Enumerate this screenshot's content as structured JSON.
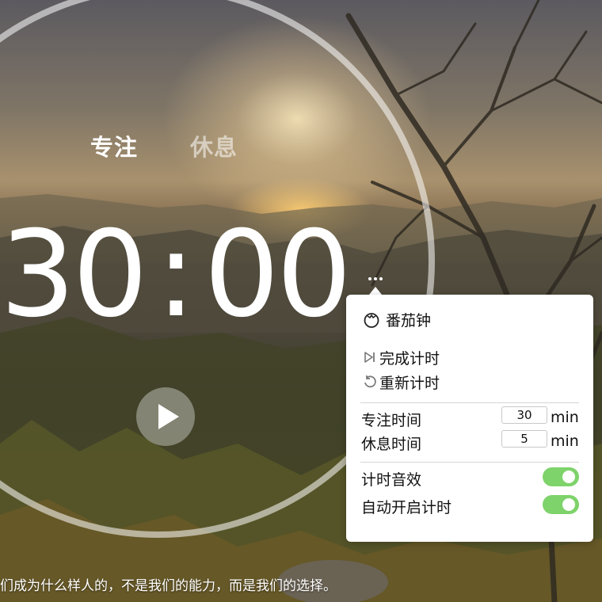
{
  "tabs": {
    "focus": "专注",
    "rest": "休息"
  },
  "timer": {
    "minutes": "30",
    "separator": ":",
    "seconds": "00"
  },
  "quote": "们成为什么样人的，不是我们的能力，而是我们的选择。",
  "panel": {
    "title": "番茄钟",
    "actions": {
      "finish": "完成计时",
      "restart": "重新计时"
    },
    "focus_label": "专注时间",
    "focus_value": "30",
    "rest_label": "休息时间",
    "rest_value": "5",
    "unit": "min",
    "sound_label": "计时音效",
    "sound_on": true,
    "auto_label": "自动开启计时",
    "auto_on": true
  },
  "colors": {
    "toggle_on": "#7ed36b",
    "panel_bg": "#ffffff"
  },
  "icons": {
    "panel_title": "tomato-icon",
    "finish": "skip-end-icon",
    "restart": "refresh-icon",
    "play": "play-icon",
    "more": "more-dots-icon"
  }
}
